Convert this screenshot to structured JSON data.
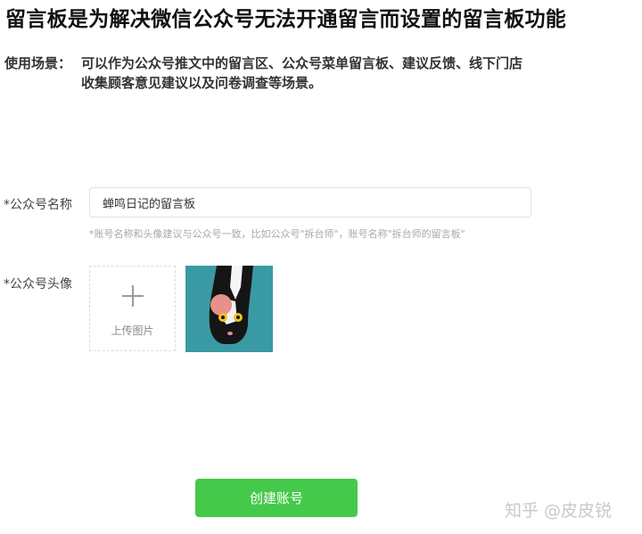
{
  "page": {
    "title": "留言板是为解决微信公众号无法开通留言而设置的留言板功能"
  },
  "usage": {
    "label": "使用场景：",
    "line1": "可以作为公众号推文中的留言区、公众号菜单留言板、建议反馈、线下门店",
    "line2": "收集顾客意见建议以及问卷调查等场景。"
  },
  "form": {
    "account_name": {
      "label": "*公众号名称",
      "value": "蝉鸣日记的留言板",
      "hint": "*账号名称和头像建议与公众号一致，比如公众号\"拆台师\"，账号名称\"拆台师的留言板\""
    },
    "avatar": {
      "label": "*公众号头像",
      "upload_label": "上传图片",
      "upload_icon": "plus-icon",
      "preview_icon": "cat-avatar-image"
    },
    "submit_label": "创建账号"
  },
  "watermark": "知乎 @皮皮锐",
  "colors": {
    "accent": "#45c94a",
    "avatar_bg": "#3a9aa3"
  }
}
